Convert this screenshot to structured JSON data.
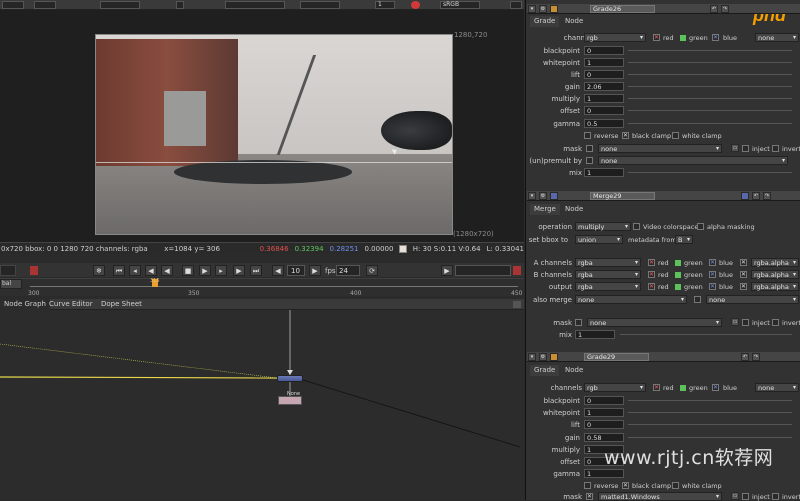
{
  "viewer": {
    "toolbar": {
      "frame_value": "1",
      "colorspace": "sRGB"
    },
    "resolution_label": "1280,720",
    "format_label": "(1280x720)",
    "info": {
      "bbox_text": "0x720 bbox: 0 0 1280 720 channels: rgba",
      "coords": "x=1084 y= 306",
      "r": "0.36846",
      "g": "0.32394",
      "b": "0.28251",
      "a": "0.00000",
      "hsv": "H: 30 S:0.11 V:0.64",
      "l": "L: 0.33041"
    }
  },
  "transport": {
    "increment": "10",
    "fps_label": "fps",
    "fps": "24"
  },
  "ruler": {
    "left_label": "bal",
    "ticks": [
      "300",
      "350",
      "400",
      "450"
    ],
    "marker": "315"
  },
  "graph": {
    "tabs": [
      "Node Graph",
      "Curve Editor",
      "Dope Sheet"
    ],
    "small_node_label": "None"
  },
  "grade26": {
    "title": "Grade26",
    "tabs": [
      "Grade",
      "Node"
    ],
    "channels_label": "channels",
    "channels_value": "rgb",
    "red": "red",
    "green": "green",
    "blue": "blue",
    "extra": "none",
    "rows": [
      {
        "label": "blackpoint",
        "value": "0"
      },
      {
        "label": "whitepoint",
        "value": "1"
      },
      {
        "label": "lift",
        "value": "0"
      },
      {
        "label": "gain",
        "value": "2.06"
      },
      {
        "label": "multiply",
        "value": "1"
      },
      {
        "label": "offset",
        "value": "0"
      },
      {
        "label": "gamma",
        "value": "0.5"
      }
    ],
    "reverse": "reverse",
    "black_clamp": "black clamp",
    "white_clamp": "white clamp",
    "mask_label": "mask",
    "mask_value": "none",
    "inject": "inject",
    "invert": "invert",
    "unpremult_label": "(un)premult by",
    "unpremult_value": "none",
    "mix_label": "mix",
    "mix_value": "1"
  },
  "merge29": {
    "title": "Merge29",
    "tabs": [
      "Merge",
      "Node"
    ],
    "operation_label": "operation",
    "operation_value": "multiply",
    "video_colorspace": "Video colorspace",
    "alpha_masking": "alpha masking",
    "bbox_label": "set bbox to",
    "bbox_value": "union",
    "metadata_label": "metadata from",
    "metadata_value": "B",
    "channel_rows": [
      {
        "label": "A channels",
        "value": "rgba",
        "alpha": "rgba.alpha"
      },
      {
        "label": "B channels",
        "value": "rgba",
        "alpha": "rgba.alpha"
      },
      {
        "label": "output",
        "value": "rgba",
        "alpha": "rgba.alpha"
      }
    ],
    "red": "red",
    "green": "green",
    "blue": "blue",
    "also_merge_label": "also merge",
    "also_merge_value": "none",
    "also_merge_extra": "none",
    "mask_label": "mask",
    "mask_value": "none",
    "inject": "inject",
    "invert": "invert",
    "mix_label": "mix",
    "mix_value": "1"
  },
  "grade29": {
    "title": "Grade29",
    "tabs": [
      "Grade",
      "Node"
    ],
    "channels_label": "channels",
    "channels_value": "rgb",
    "red": "red",
    "green": "green",
    "blue": "blue",
    "extra": "none",
    "rows": [
      {
        "label": "blackpoint",
        "value": "0"
      },
      {
        "label": "whitepoint",
        "value": "1"
      },
      {
        "label": "lift",
        "value": "0"
      },
      {
        "label": "gain",
        "value": "0.58"
      },
      {
        "label": "multiply",
        "value": "1"
      },
      {
        "label": "offset",
        "value": "0"
      },
      {
        "label": "gamma",
        "value": "1"
      }
    ],
    "reverse": "reverse",
    "black_clamp": "black clamp",
    "white_clamp": "white clamp",
    "mask_label": "mask",
    "mask_value": "matted1.Windows",
    "inject": "inject",
    "invert": "invert"
  },
  "branding": {
    "logo": "phd",
    "watermark": "www.rjtj.cn软荐网"
  },
  "colors": {
    "red_swatch": "#d84a4a",
    "green_swatch": "#5cc35c",
    "blue_swatch": "#5b7fe0",
    "node_blue": "#5868a8",
    "accent_yellow": "#e8d84a"
  }
}
